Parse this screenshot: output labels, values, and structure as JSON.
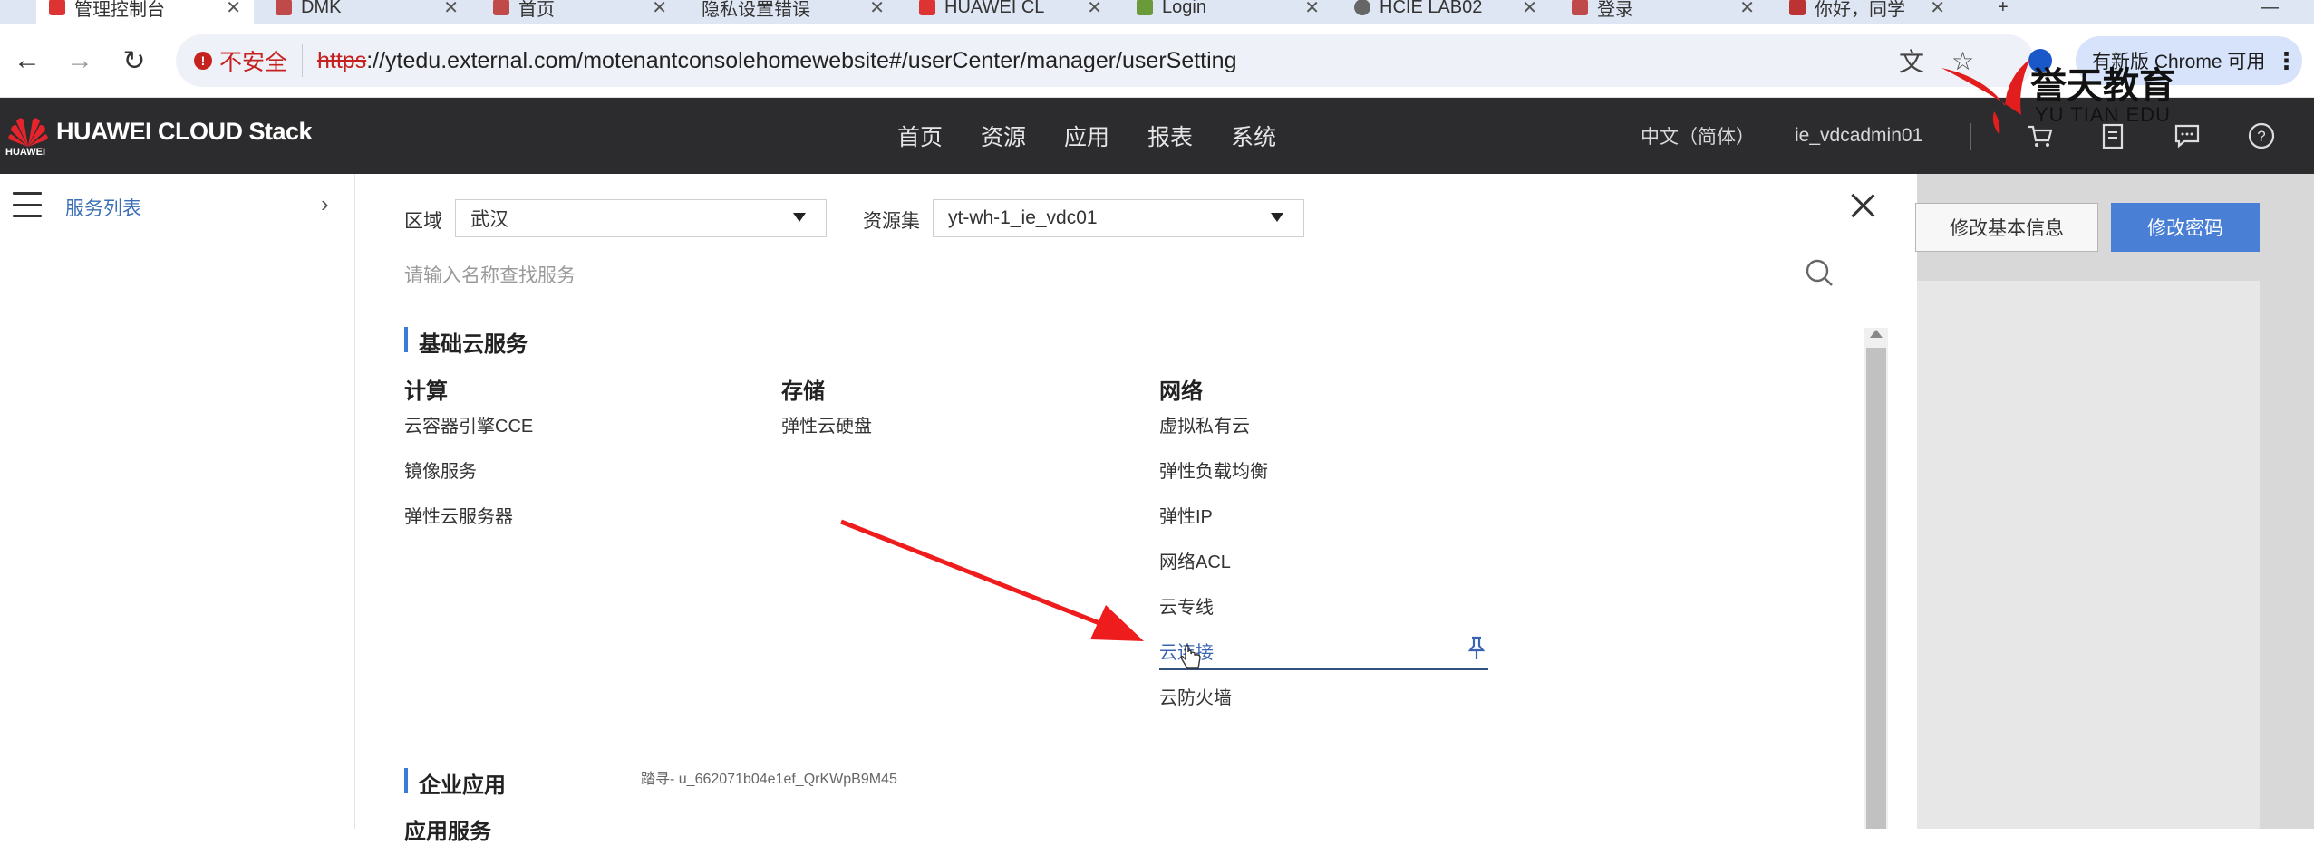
{
  "browser": {
    "tabs": [
      {
        "label": "管理控制台",
        "active": true
      },
      {
        "label": "DMK"
      },
      {
        "label": "首页"
      },
      {
        "label": "隐私设置错误"
      },
      {
        "label": "HUAWEI CL"
      },
      {
        "label": "Login"
      },
      {
        "label": "HCIE LAB02"
      },
      {
        "label": "登录"
      },
      {
        "label": "你好，同学"
      }
    ],
    "security_label": "不安全",
    "url_scheme": "https",
    "url_rest": "://ytedu.external.com/motenantconsolehomewebsite#/userCenter/manager/userSetting",
    "update_label": "有新版 Chrome 可用"
  },
  "header": {
    "logo_text": "HUAWEI CLOUD Stack",
    "logo_sub": "HUAWEI",
    "nav": [
      "首页",
      "资源",
      "应用",
      "报表",
      "系统"
    ],
    "language": "中文（简体）",
    "username": "ie_vdcadmin01"
  },
  "sidebar": {
    "label": "服务列表"
  },
  "panel": {
    "region_label": "区域",
    "region_value": "武汉",
    "resource_label": "资源集",
    "resource_value": "yt-wh-1_ie_vdc01",
    "search_placeholder": "请输入名称查找服务",
    "sections": [
      {
        "title": "基础云服务",
        "categories": [
          {
            "title": "计算",
            "items": [
              "云容器引擎CCE",
              "镜像服务",
              "弹性云服务器"
            ]
          },
          {
            "title": "存储",
            "items": [
              "弹性云硬盘"
            ]
          },
          {
            "title": "网络",
            "items": [
              "虚拟私有云",
              "弹性负载均衡",
              "弹性IP",
              "网络ACL",
              "云专线",
              "云连接",
              "云防火墙"
            ]
          }
        ]
      },
      {
        "title": "企业应用",
        "categories": [
          {
            "title": "应用服务",
            "items": []
          }
        ]
      }
    ],
    "watermark": "踏寻- u_662071b04e1ef_QrKWpB9M45"
  },
  "right": {
    "edit_basic_label": "修改基本信息",
    "change_password_label": "修改密码"
  },
  "overlay": {
    "brand_cn": "誉天教育",
    "brand_en": "YU TIAN EDU"
  },
  "colors": {
    "header_bg": "#2c2c2f",
    "accent_blue": "#4a7fd6",
    "section_bar": "#3a7bd5",
    "annotation_arrow": "#ee1c1c",
    "insecure_red": "#c5221f"
  }
}
